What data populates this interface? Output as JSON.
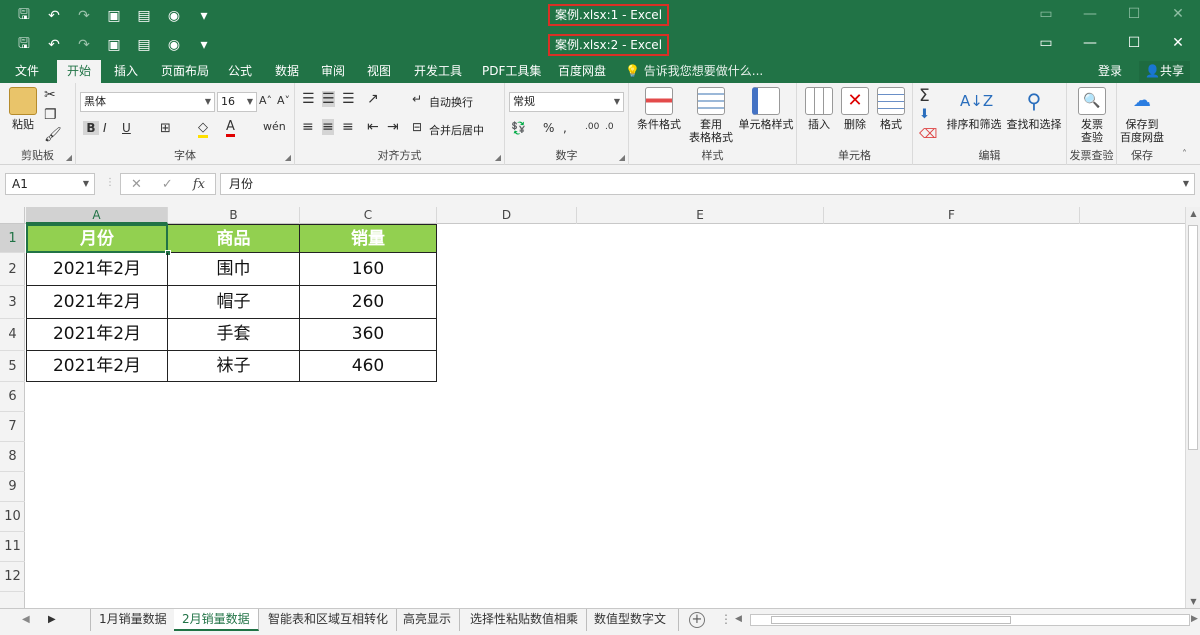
{
  "window1": {
    "title": "案例.xlsx:1 - Excel"
  },
  "window2": {
    "title": "案例.xlsx:2 - Excel"
  },
  "qat": {
    "save": "🖫",
    "undo": "↶",
    "redo": "↷",
    "more": "▾"
  },
  "tabs": [
    {
      "label": "文件"
    },
    {
      "label": "开始"
    },
    {
      "label": "插入"
    },
    {
      "label": "页面布局"
    },
    {
      "label": "公式"
    },
    {
      "label": "数据"
    },
    {
      "label": "审阅"
    },
    {
      "label": "视图"
    },
    {
      "label": "开发工具"
    },
    {
      "label": "PDF工具集"
    },
    {
      "label": "百度网盘"
    }
  ],
  "tell_me": "告诉我您想要做什么...",
  "login": "登录",
  "share": "共享",
  "ribbon": {
    "clipboard": {
      "label": "剪贴板",
      "paste": "粘贴"
    },
    "font": {
      "label": "字体",
      "name": "黑体",
      "size": "16"
    },
    "alignment": {
      "label": "对齐方式",
      "wrap": "自动换行",
      "merge": "合并后居中"
    },
    "number": {
      "label": "数字",
      "format": "常规"
    },
    "styles": {
      "label": "样式",
      "cond": "条件格式",
      "table": "套用\n表格格式",
      "cell": "单元格样式"
    },
    "cells": {
      "label": "单元格",
      "insert": "插入",
      "delete": "删除",
      "format": "格式"
    },
    "editing": {
      "label": "编辑",
      "sort": "排序和筛选",
      "find": "查找和选择"
    },
    "invoice": {
      "label": "发票查验",
      "btn": "发票\n查验"
    },
    "save": {
      "label": "保存",
      "btn": "保存到\n百度网盘"
    }
  },
  "formula_bar": {
    "name_box": "A1",
    "content": "月份"
  },
  "columns": [
    "A",
    "B",
    "C",
    "D",
    "E",
    "F"
  ],
  "rows": [
    "1",
    "2",
    "3",
    "4",
    "5",
    "6",
    "7",
    "8",
    "9",
    "10",
    "11",
    "12"
  ],
  "table": {
    "headers": [
      "月份",
      "商品",
      "销量"
    ],
    "rows": [
      [
        "2021年2月",
        "围巾",
        "160"
      ],
      [
        "2021年2月",
        "帽子",
        "260"
      ],
      [
        "2021年2月",
        "手套",
        "360"
      ],
      [
        "2021年2月",
        "袜子",
        "460"
      ]
    ]
  },
  "sheets": [
    "1月销量数据",
    "2月销量数据",
    "智能表和区域互相转化",
    "高亮显示",
    "选择性粘贴数值相乘",
    "数值型数字文"
  ],
  "colors": {
    "accent": "#217346",
    "header_fill": "#92d050",
    "highlight_box": "#d93025"
  }
}
